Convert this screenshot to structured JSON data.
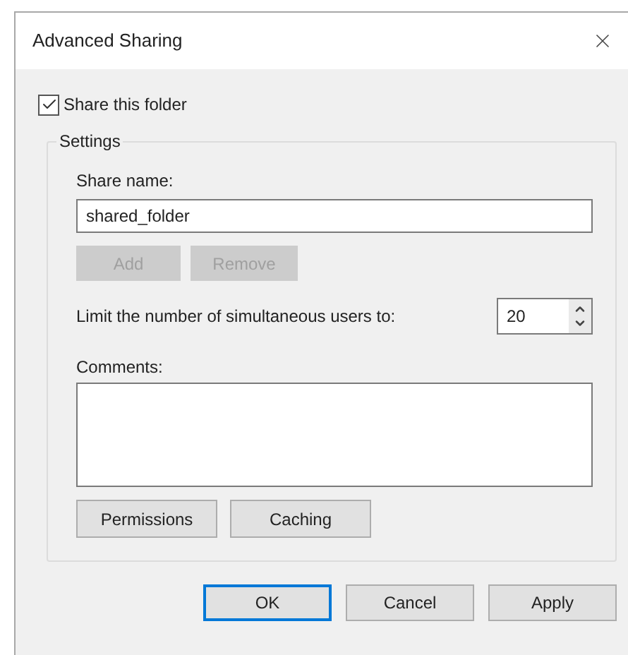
{
  "window": {
    "title": "Advanced Sharing"
  },
  "share_checkbox": {
    "label": "Share this folder",
    "checked": true
  },
  "settings": {
    "title": "Settings",
    "share_name": {
      "label": "Share name:",
      "value": "shared_folder"
    },
    "share_buttons": [
      {
        "label": "Add",
        "disabled": true
      },
      {
        "label": "Remove",
        "disabled": true
      }
    ],
    "user_limit": {
      "label": "Limit the number of simultaneous users to:",
      "value": "20"
    },
    "comments": {
      "label": "Comments:"
    },
    "buttons": [
      {
        "label": "Permissions",
        "disabled": false
      },
      {
        "label": "Caching",
        "disabled": false
      }
    ]
  },
  "dialog_buttons": [
    {
      "label": "OK",
      "default": true
    },
    {
      "label": "Cancel",
      "default": false
    },
    {
      "label": "Apply",
      "default": false
    }
  ]
}
